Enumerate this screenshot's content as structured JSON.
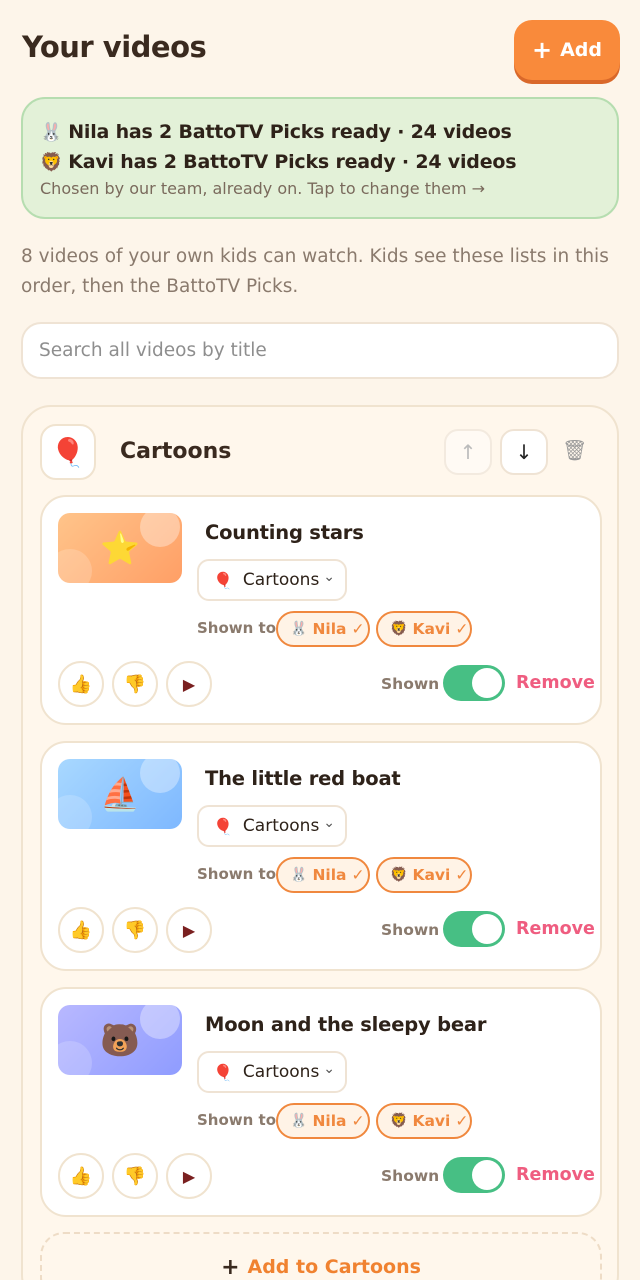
{
  "header": {
    "title": "Your videos",
    "add_label": "Add"
  },
  "picks_banner": {
    "lines": [
      {
        "emoji": "🐰",
        "text": "Nila has 2 BattoTV Picks ready · 24 videos"
      },
      {
        "emoji": "🦁",
        "text": "Kavi has 2 BattoTV Picks ready · 24 videos"
      }
    ],
    "subtext": "Chosen by our team, already on. Tap to change them →"
  },
  "intro": "8 videos of your own kids can watch. Kids see these lists in this order, then the BattoTV Picks.",
  "search": {
    "placeholder": "Search all videos by title"
  },
  "list": {
    "emoji": "🎈",
    "title": "Cartoons",
    "up_icon": "↑",
    "down_icon": "↓",
    "trash_icon": "🗑",
    "videos": [
      {
        "title": "Counting stars",
        "thumb_emoji": "⭐",
        "thumb_gradient": [
          "#ffc48a",
          "#ff9f66"
        ],
        "category": "Cartoons",
        "shown_to_label": "Shown to",
        "kids": [
          {
            "emoji": "🐰",
            "name": "Nila"
          },
          {
            "emoji": "🦁",
            "name": "Kavi"
          }
        ],
        "shown_label": "Shown",
        "shown": true,
        "remove_label": "Remove"
      },
      {
        "title": "The little red boat",
        "thumb_emoji": "⛵",
        "thumb_gradient": [
          "#a8d8ff",
          "#7eb8ff"
        ],
        "category": "Cartoons",
        "shown_to_label": "Shown to",
        "kids": [
          {
            "emoji": "🐰",
            "name": "Nila"
          },
          {
            "emoji": "🦁",
            "name": "Kavi"
          }
        ],
        "shown_label": "Shown",
        "shown": true,
        "remove_label": "Remove"
      },
      {
        "title": "Moon and the sleepy bear",
        "thumb_emoji": "🐻",
        "thumb_gradient": [
          "#b8b8ff",
          "#8f9cff"
        ],
        "category": "Cartoons",
        "shown_to_label": "Shown to",
        "kids": [
          {
            "emoji": "🐰",
            "name": "Nila"
          },
          {
            "emoji": "🦁",
            "name": "Kavi"
          }
        ],
        "shown_label": "Shown",
        "shown": true,
        "remove_label": "Remove"
      }
    ],
    "add_to_label": "Add to Cartoons"
  },
  "colors": {
    "accent": "#f98a3b",
    "toggle_on": "#47bf84",
    "remove": "#ef5d80",
    "banner_bg": "#e3f1d8"
  },
  "icons": {
    "like": "thumbs-up-icon",
    "dislike": "thumbs-down-icon",
    "flag": "flag-icon",
    "check": "check-icon"
  }
}
